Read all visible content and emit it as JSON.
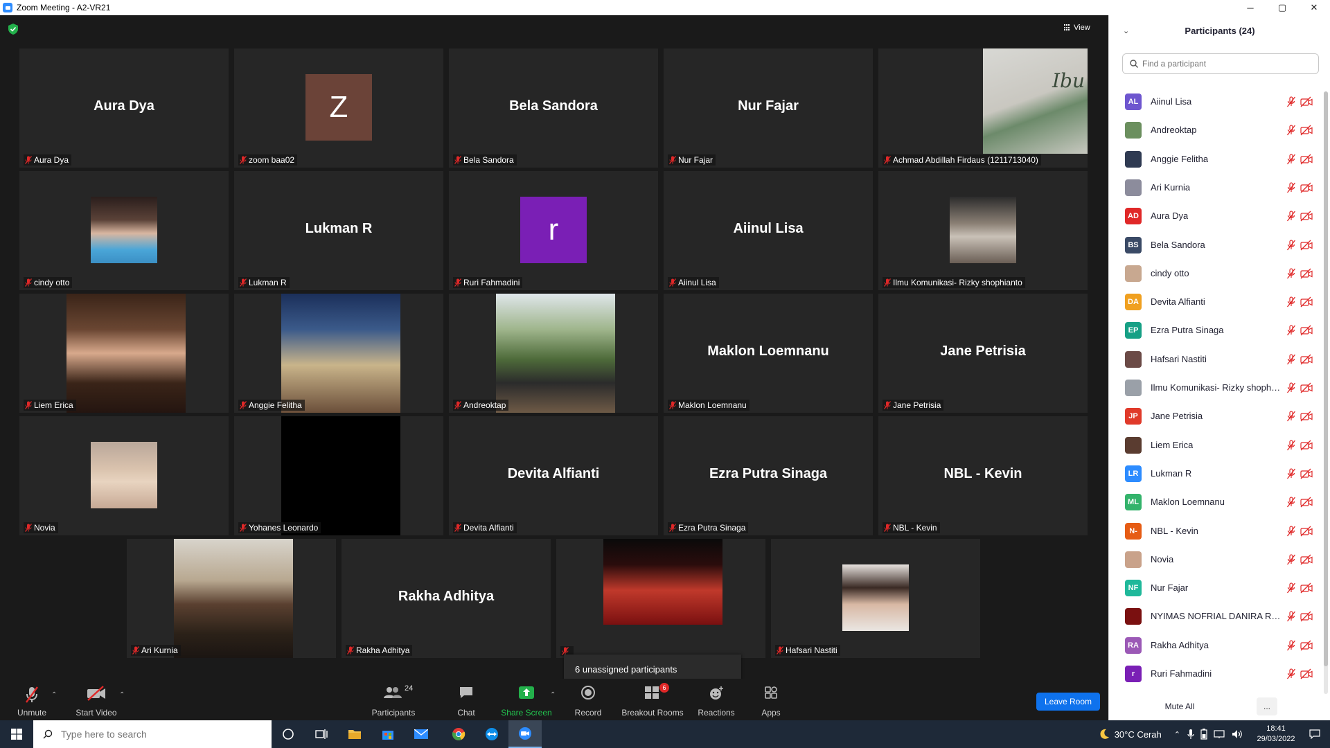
{
  "window": {
    "title": "Zoom Meeting - A2-VR21",
    "min": "─",
    "max": "▢",
    "close": "✕"
  },
  "meeting": {
    "view_label": "View"
  },
  "tiles": [
    {
      "big": "Aura Dya",
      "label": "Aura Dya"
    },
    {
      "avatar": "Z",
      "avatar_color": "#6b4338",
      "label": "zoom baa02"
    },
    {
      "big": "Bela Sandora",
      "label": "Bela Sandora"
    },
    {
      "big": "Nur Fajar",
      "label": "Nur Fajar"
    },
    {
      "label": "Achmad Abdillah Firdaus (1211713040)",
      "poster_text": "Ibu"
    },
    {
      "label": "cindy otto"
    },
    {
      "big": "Lukman R",
      "label": "Lukman R"
    },
    {
      "avatar": "r",
      "avatar_color": "#7a1fb5",
      "label": "Ruri Fahmadini"
    },
    {
      "big": "Aiinul Lisa",
      "label": "Aiinul Lisa"
    },
    {
      "label": "Ilmu Komunikasi- Rizky shophianto"
    },
    {
      "label": "Liem Erica"
    },
    {
      "label": "Anggie Felitha"
    },
    {
      "label": "Andreoktap"
    },
    {
      "big": "Maklon Loemnanu",
      "label": "Maklon Loemnanu"
    },
    {
      "big": "Jane Petrisia",
      "label": "Jane Petrisia"
    },
    {
      "label": "Novia"
    },
    {
      "label": "Yohanes Leonardo"
    },
    {
      "big": "Devita Alfianti",
      "label": "Devita Alfianti"
    },
    {
      "big": "Ezra Putra Sinaga",
      "label": "Ezra Putra Sinaga"
    },
    {
      "big": "NBL - Kevin",
      "label": "NBL - Kevin"
    },
    {
      "label": "Ari Kurnia"
    },
    {
      "big": "Rakha Adhitya",
      "label": "Rakha Adhitya"
    },
    {
      "label": ""
    },
    {
      "label": "Hafsari Nastiti"
    }
  ],
  "unassigned_popup": "6 unassigned participants",
  "toolbar": {
    "unmute": "Unmute",
    "start_video": "Start Video",
    "participants": "Participants",
    "participants_count": "24",
    "chat": "Chat",
    "share_screen": "Share Screen",
    "record": "Record",
    "breakout_rooms": "Breakout Rooms",
    "breakout_badge": "6",
    "reactions": "Reactions",
    "apps": "Apps",
    "leave": "Leave Room"
  },
  "panel": {
    "title": "Participants (24)",
    "search_placeholder": "Find a participant",
    "mute_all": "Mute All",
    "more": "...",
    "participants": [
      {
        "initials": "AL",
        "color": "#6e56cf",
        "name": "Aiinul Lisa"
      },
      {
        "initials": "",
        "color": "#6b8f5e",
        "name": "Andreoktap"
      },
      {
        "initials": "",
        "color": "#2f3a52",
        "name": "Anggie Felitha"
      },
      {
        "initials": "",
        "color": "#8c8c9c",
        "name": "Ari Kurnia"
      },
      {
        "initials": "AD",
        "color": "#e02828",
        "name": "Aura Dya"
      },
      {
        "initials": "BS",
        "color": "#3a4a66",
        "name": "Bela Sandora"
      },
      {
        "initials": "",
        "color": "#c8a890",
        "name": "cindy otto"
      },
      {
        "initials": "DA",
        "color": "#f0a020",
        "name": "Devita Alfianti"
      },
      {
        "initials": "EP",
        "color": "#16a085",
        "name": "Ezra Putra Sinaga"
      },
      {
        "initials": "",
        "color": "#6b4a46",
        "name": "Hafsari Nastiti"
      },
      {
        "initials": "",
        "color": "#9aa0a8",
        "name": "Ilmu Komunikasi- Rizky shophia..."
      },
      {
        "initials": "JP",
        "color": "#e03a2a",
        "name": "Jane Petrisia"
      },
      {
        "initials": "",
        "color": "#5a3c30",
        "name": "Liem Erica"
      },
      {
        "initials": "LR",
        "color": "#2d8cff",
        "name": "Lukman R"
      },
      {
        "initials": "ML",
        "color": "#33b36b",
        "name": "Maklon Loemnanu"
      },
      {
        "initials": "N-",
        "color": "#e65c14",
        "name": "NBL - Kevin"
      },
      {
        "initials": "",
        "color": "#c9a28a",
        "name": "Novia"
      },
      {
        "initials": "NF",
        "color": "#1fb89a",
        "name": "Nur Fajar"
      },
      {
        "initials": "",
        "color": "#7a1010",
        "name": "NYIMAS NOFRIAL DANIRA RIAN"
      },
      {
        "initials": "RA",
        "color": "#9b59b6",
        "name": "Rakha Adhitya"
      },
      {
        "initials": "r",
        "color": "#7a1fb5",
        "name": "Ruri Fahmadini"
      }
    ]
  },
  "taskbar": {
    "search_placeholder": "Type here to search",
    "weather": "30°C  Cerah",
    "time": "18:41",
    "date": "29/03/2022"
  }
}
